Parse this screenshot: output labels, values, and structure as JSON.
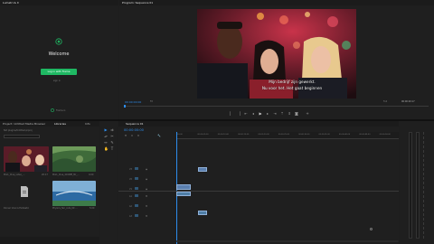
{
  "left_panel": {
    "tab_label": "Lumetri & II",
    "welcome_title": "Welcome",
    "login_button": "Log in with Frame",
    "sub_link": "sign in",
    "footer_label": "Frame.io"
  },
  "program_monitor": {
    "tab_label": "Program: Sequence 01",
    "subtitle_line1": "Mijn bedrijf zijn gewerkt.",
    "subtitle_line2": "Nu voor het. Het gaat beginnen",
    "timecode_left": "00:00:00:00",
    "fit_label": "Fit",
    "quality_label": "Full",
    "timecode_right": "00:00:20:17"
  },
  "project_panel": {
    "tabs": [
      "Project: Untitled",
      "Media Browser",
      "Libraries",
      "Info"
    ],
    "active_tab_index": 2,
    "path": "Not plugins/Untitled.prproj",
    "items": [
      {
        "name": "Mix1_Clue_video_...",
        "duration": "20:17"
      },
      {
        "name": "Mix1_Clue_4COME_Mr_...",
        "duration": "4:00"
      },
      {
        "name": "Dinner Vive Is Fantastic",
        "duration": ""
      },
      {
        "name": "Physics_fair_cuts_00 ...",
        "duration": "5:00"
      }
    ]
  },
  "sequence_panel": {
    "tab_label": "Sequence 01",
    "timecode": "00:00:00:00",
    "ruler_labels": [
      "00:00",
      "00:00:05:00",
      "00:00:10:00",
      "00:00:15:00",
      "00:00:20:00",
      "00:00:25:00",
      "00:00:30:00",
      "00:00:35:00",
      "00:00:40:00",
      "00:00:45:00",
      "00:00:50:00"
    ],
    "track_labels": [
      "V3",
      "V2",
      "V1",
      "A1",
      "A2",
      "A3"
    ]
  },
  "colors": {
    "accent_blue": "#2d8ceb",
    "login_green": "#1fb863",
    "clip_video": "#5b7fae",
    "clip_audio": "#4f7ea6"
  }
}
